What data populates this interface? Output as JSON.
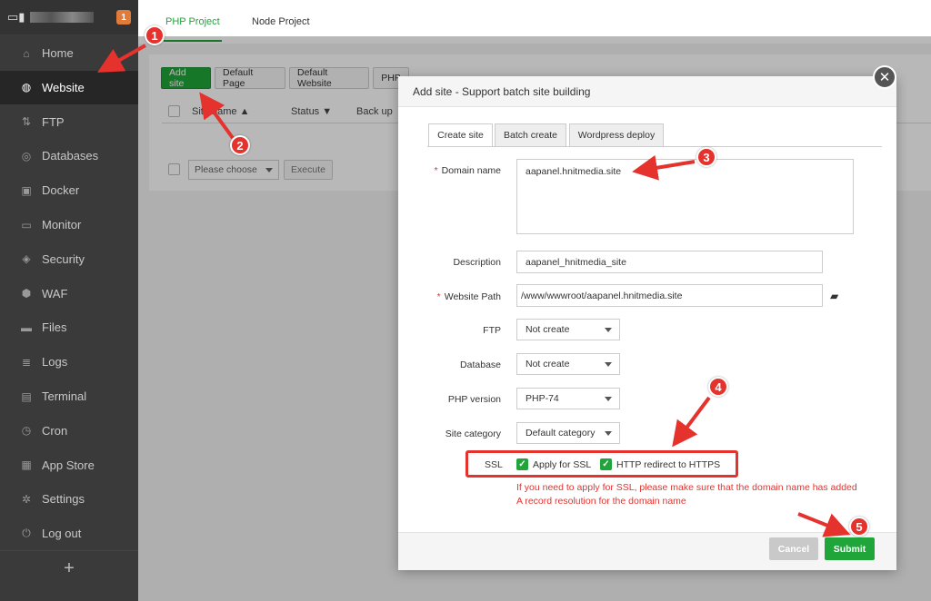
{
  "sidebar": {
    "badge": "1",
    "items": [
      {
        "label": "Home",
        "icon": "home-icon",
        "glyph": "⌂"
      },
      {
        "label": "Website",
        "icon": "globe-icon",
        "glyph": "◍"
      },
      {
        "label": "FTP",
        "icon": "ftp-icon",
        "glyph": "⇅"
      },
      {
        "label": "Databases",
        "icon": "database-icon",
        "glyph": "◎"
      },
      {
        "label": "Docker",
        "icon": "docker-icon",
        "glyph": "▣"
      },
      {
        "label": "Monitor",
        "icon": "monitor-icon",
        "glyph": "▭"
      },
      {
        "label": "Security",
        "icon": "shield-icon",
        "glyph": "◈"
      },
      {
        "label": "WAF",
        "icon": "waf-shield-icon",
        "glyph": "⬢"
      },
      {
        "label": "Files",
        "icon": "folder-icon",
        "glyph": "▬"
      },
      {
        "label": "Logs",
        "icon": "logs-icon",
        "glyph": "≣"
      },
      {
        "label": "Terminal",
        "icon": "terminal-icon",
        "glyph": "▤"
      },
      {
        "label": "Cron",
        "icon": "clock-icon",
        "glyph": "◷"
      },
      {
        "label": "App Store",
        "icon": "app-grid-icon",
        "glyph": "▦"
      },
      {
        "label": "Settings",
        "icon": "gear-icon",
        "glyph": "✲"
      },
      {
        "label": "Log out",
        "icon": "logout-icon",
        "glyph": "⏻"
      }
    ],
    "plus": "+"
  },
  "topbar": {
    "tab_php": "PHP Project",
    "tab_node": "Node Project"
  },
  "toolbar": {
    "add_site": "Add site",
    "default_page": "Default Page",
    "default_website": "Default Website",
    "php_partial": "PHP"
  },
  "table": {
    "col_site_name": "Site name ▲",
    "col_status": "Status ▼",
    "col_backup": "Back up"
  },
  "batch": {
    "select_placeholder": "Please choose",
    "execute": "Execute"
  },
  "modal": {
    "title": "Add site - Support batch site building",
    "tabs": [
      "Create site",
      "Batch create",
      "Wordpress deploy"
    ],
    "fields": {
      "domain_label": "Domain name",
      "domain_value": "aapanel.hnitmedia.site",
      "description_label": "Description",
      "description_value": "aapanel_hnitmedia_site",
      "path_label": "Website Path",
      "path_value": "/www/wwwroot/aapanel.hnitmedia.site",
      "ftp_label": "FTP",
      "ftp_value": "Not create",
      "database_label": "Database",
      "database_value": "Not create",
      "php_label": "PHP version",
      "php_value": "PHP-74",
      "category_label": "Site category",
      "category_value": "Default category"
    },
    "ssl": {
      "label": "SSL",
      "apply": "Apply for SSL",
      "redirect": "HTTP redirect to HTTPS",
      "warning": "If you need to apply for SSL, please make sure that the domain name has added A record resolution for the domain name"
    },
    "cancel": "Cancel",
    "submit": "Submit"
  },
  "annotations": [
    "1",
    "2",
    "3",
    "4",
    "5"
  ],
  "colors": {
    "accent": "#20a53a",
    "annotation": "#e5322d",
    "sidebar_bg": "#3a3a3a"
  }
}
